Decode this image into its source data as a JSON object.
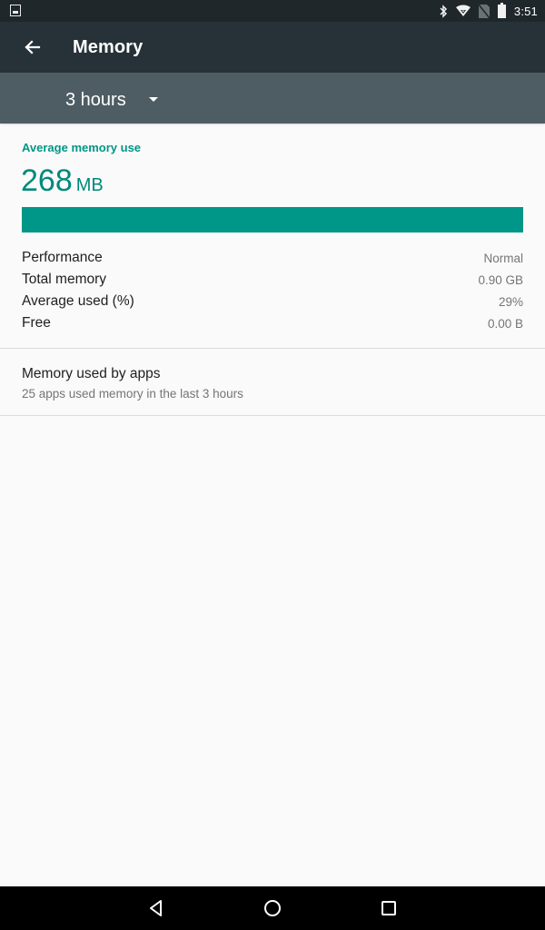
{
  "status_bar": {
    "time": "3:51",
    "icons": [
      "image-notification-icon",
      "bluetooth-icon",
      "wifi-icon",
      "no-sim-signal-icon",
      "battery-icon"
    ]
  },
  "toolbar": {
    "back_icon": "arrow-left-icon",
    "title": "Memory"
  },
  "period_selector": {
    "selected": "3 hours",
    "icon": "dropdown-caret-icon"
  },
  "summary": {
    "section_label": "Average memory use",
    "value": "268",
    "unit": "MB",
    "bar_fill_fraction": 1.0,
    "accent_color": "#009688"
  },
  "stats": [
    {
      "label": "Performance",
      "value": "Normal"
    },
    {
      "label": "Total memory",
      "value": "0.90 GB"
    },
    {
      "label": "Average used (%)",
      "value": "29%"
    },
    {
      "label": "Free",
      "value": "0.00 B"
    }
  ],
  "apps_item": {
    "title": "Memory used by apps",
    "subtitle": "25 apps used memory in the last 3 hours"
  },
  "nav_bar": {
    "buttons": [
      "back-triangle-icon",
      "home-circle-icon",
      "recents-square-icon"
    ]
  }
}
